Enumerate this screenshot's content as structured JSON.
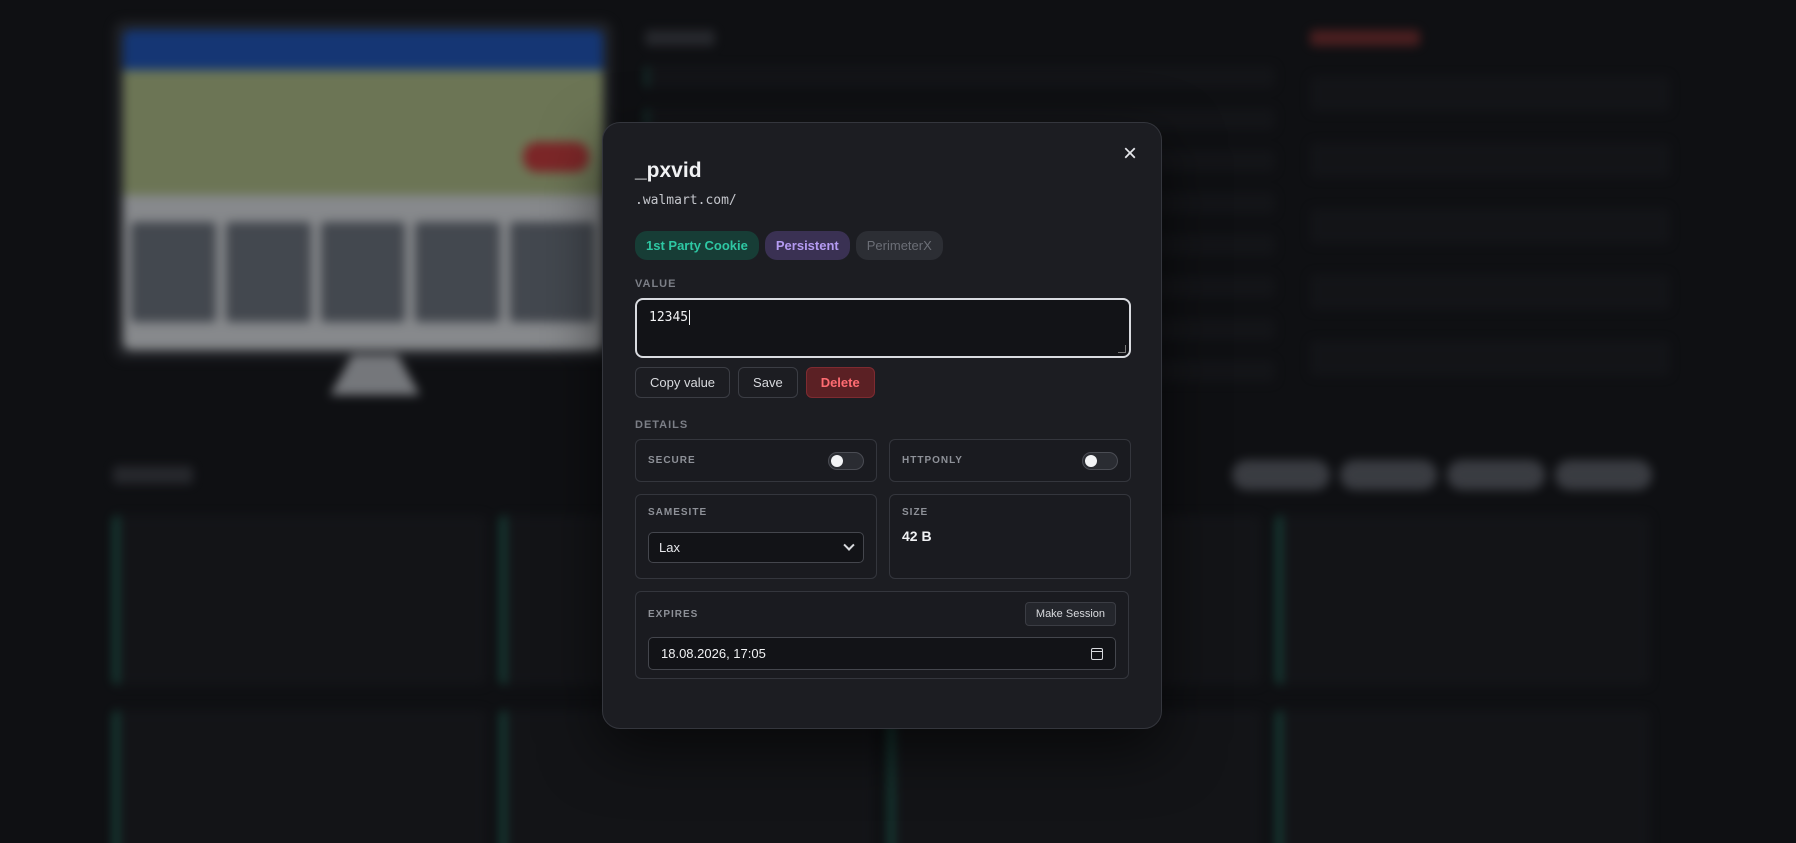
{
  "cookie": {
    "name": "_pxvid",
    "domain": ".walmart.com/",
    "badges": [
      "1st Party Cookie",
      "Persistent",
      "PerimeterX"
    ],
    "value": "12345"
  },
  "labels": {
    "value": "VALUE",
    "details": "DETAILS",
    "secure": "SECURE",
    "httponly": "HTTPONLY",
    "samesite": "SAMESITE",
    "size": "SIZE",
    "expires": "EXPIRES"
  },
  "buttons": {
    "copy": "Copy value",
    "save": "Save",
    "delete": "Delete",
    "make_session": "Make Session",
    "close": "×"
  },
  "details": {
    "secure": false,
    "httponly": false,
    "samesite": "Lax",
    "size": "42 B",
    "expires": "18.08.2026, 17:05"
  },
  "colors": {
    "party_badge": "#2ec7a3",
    "persistent_badge": "#b49bf2",
    "danger": "#ff6c72"
  }
}
